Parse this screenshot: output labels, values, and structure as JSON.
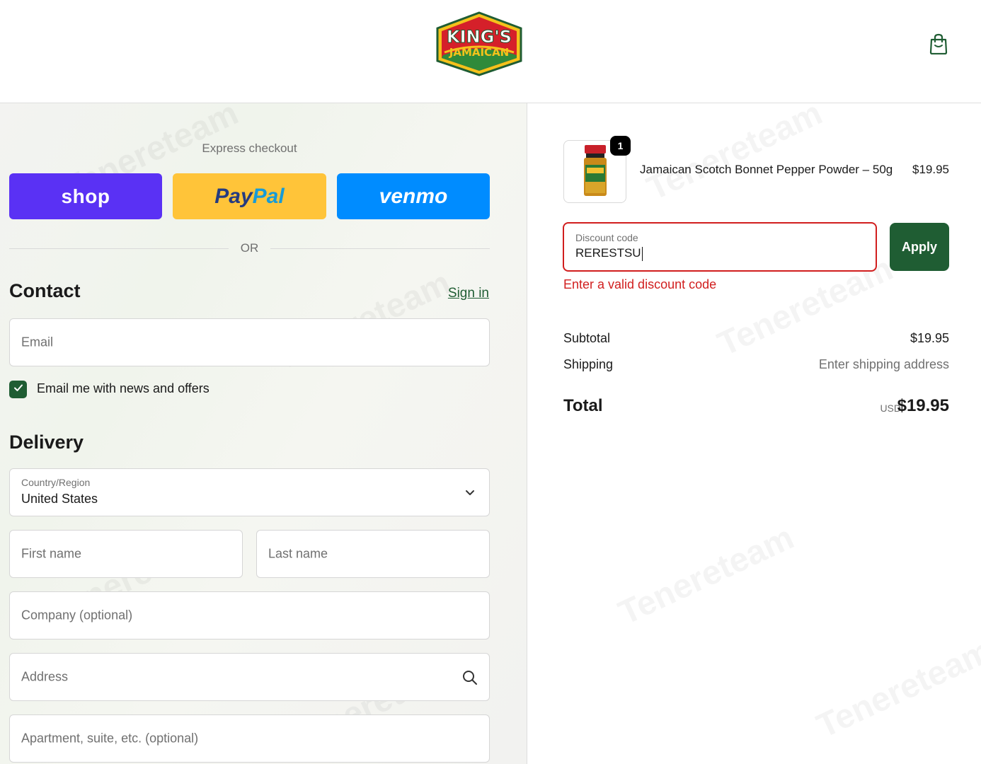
{
  "header": {
    "logo_line1": "KING'S",
    "logo_line2": "JAMAICAN",
    "cart_icon": "shopping-bag-icon"
  },
  "express": {
    "title": "Express checkout",
    "shop_label": "shop",
    "paypal_label_part1": "Pay",
    "paypal_label_part2": "Pal",
    "venmo_label": "venmo",
    "or_label": "OR"
  },
  "contact": {
    "title": "Contact",
    "signin_label": "Sign in",
    "email_placeholder": "Email",
    "newsletter_label": "Email me with news and offers",
    "newsletter_checked": true
  },
  "delivery": {
    "title": "Delivery",
    "country_label": "Country/Region",
    "country_value": "United States",
    "first_name_placeholder": "First name",
    "last_name_placeholder": "Last name",
    "company_placeholder": "Company (optional)",
    "address_placeholder": "Address",
    "apartment_placeholder": "Apartment, suite, etc. (optional)"
  },
  "order": {
    "item": {
      "quantity": "1",
      "name": "Jamaican Scotch Bonnet Pepper Powder – 50g",
      "price": "$19.95"
    },
    "discount": {
      "label": "Discount code",
      "value": "RERESTSU",
      "apply_label": "Apply",
      "error": "Enter a valid discount code"
    },
    "subtotal_label": "Subtotal",
    "subtotal_value": "$19.95",
    "shipping_label": "Shipping",
    "shipping_value": "Enter shipping address",
    "total_label": "Total",
    "total_currency": "USD",
    "total_value": "$19.95"
  },
  "colors": {
    "accent_green": "#1f5d33",
    "error_red": "#d11e1e",
    "shop_purple": "#5a31f4",
    "paypal_yellow": "#ffc439",
    "venmo_blue": "#008cff"
  }
}
